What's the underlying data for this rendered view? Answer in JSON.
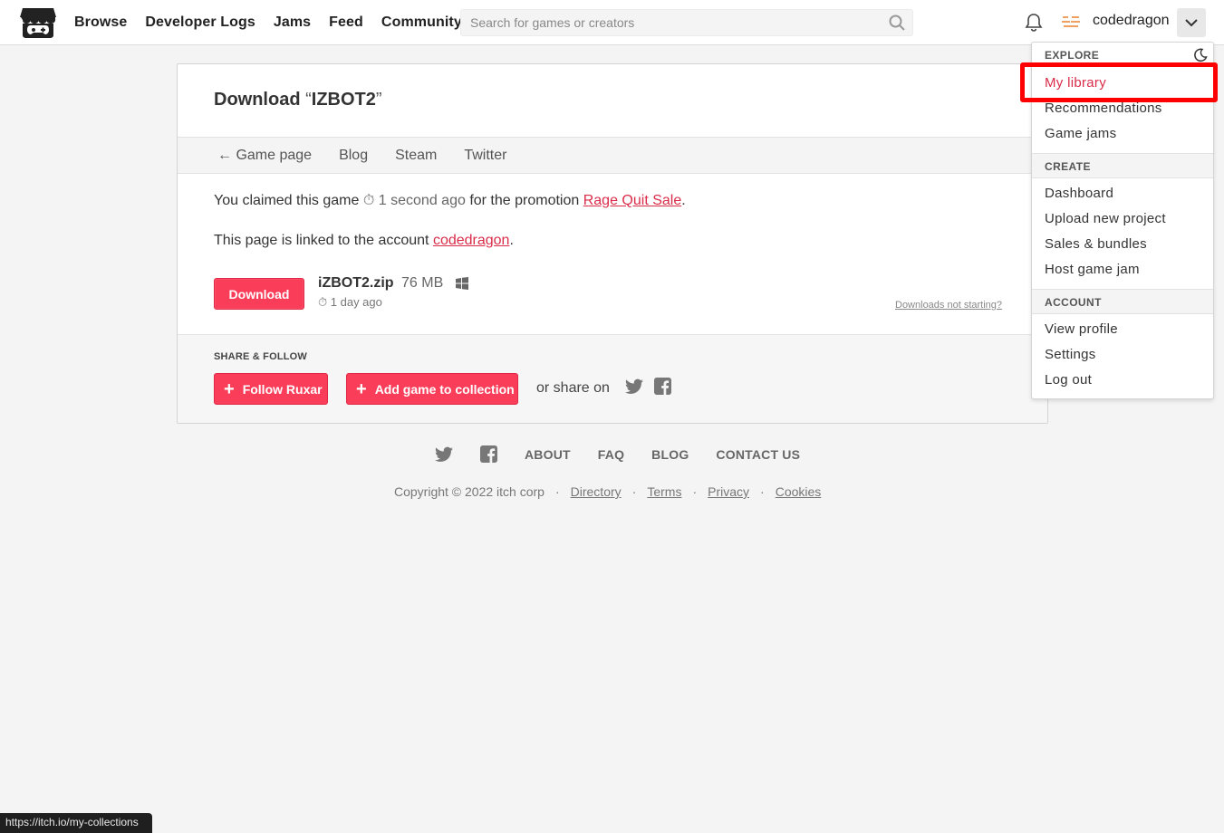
{
  "header": {
    "nav": [
      "Browse",
      "Developer Logs",
      "Jams",
      "Feed",
      "Community"
    ],
    "search_placeholder": "Search for games or creators",
    "username": "codedragon"
  },
  "card": {
    "title_prefix": "Download ",
    "title_open_quote": "“",
    "game_name": "IZBOT2",
    "title_close_quote": "”",
    "subnav": [
      "← Game page",
      "Blog",
      "Steam",
      "Twitter"
    ],
    "claim_text": "You claimed this game",
    "claim_time": "1 second ago",
    "claim_mid": "for the promotion",
    "promotion": "Rage Quit Sale",
    "claim_end": ".",
    "linked_text": "This page is linked to the account",
    "linked_account": "codedragon",
    "linked_end": ".",
    "download_label": "Download",
    "file_name": "iZBOT2.zip",
    "file_size": "76 MB",
    "file_age": "1 day ago",
    "not_starting": "Downloads not starting?",
    "share_label": "SHARE & FOLLOW",
    "follow_label": "Follow Ruxar",
    "collection_label": "Add game to collection",
    "share_on": "or share on"
  },
  "footer": {
    "links": [
      "ABOUT",
      "FAQ",
      "BLOG",
      "CONTACT US"
    ],
    "copyright": "Copyright © 2022 itch corp",
    "legal": [
      "Directory",
      "Terms",
      "Privacy",
      "Cookies"
    ],
    "separator": "·"
  },
  "menu": {
    "explore_head": "EXPLORE",
    "explore": [
      "My library",
      "Recommendations",
      "Game jams"
    ],
    "create_head": "CREATE",
    "create": [
      "Dashboard",
      "Upload new project",
      "Sales & bundles",
      "Host game jam"
    ],
    "account_head": "ACCOUNT",
    "account": [
      "View profile",
      "Settings",
      "Log out"
    ]
  },
  "status_url": "https://itch.io/my-collections",
  "colors": {
    "accent": "#fa3e5a",
    "link": "#da2c49",
    "highlight_box": "#ff0000"
  }
}
